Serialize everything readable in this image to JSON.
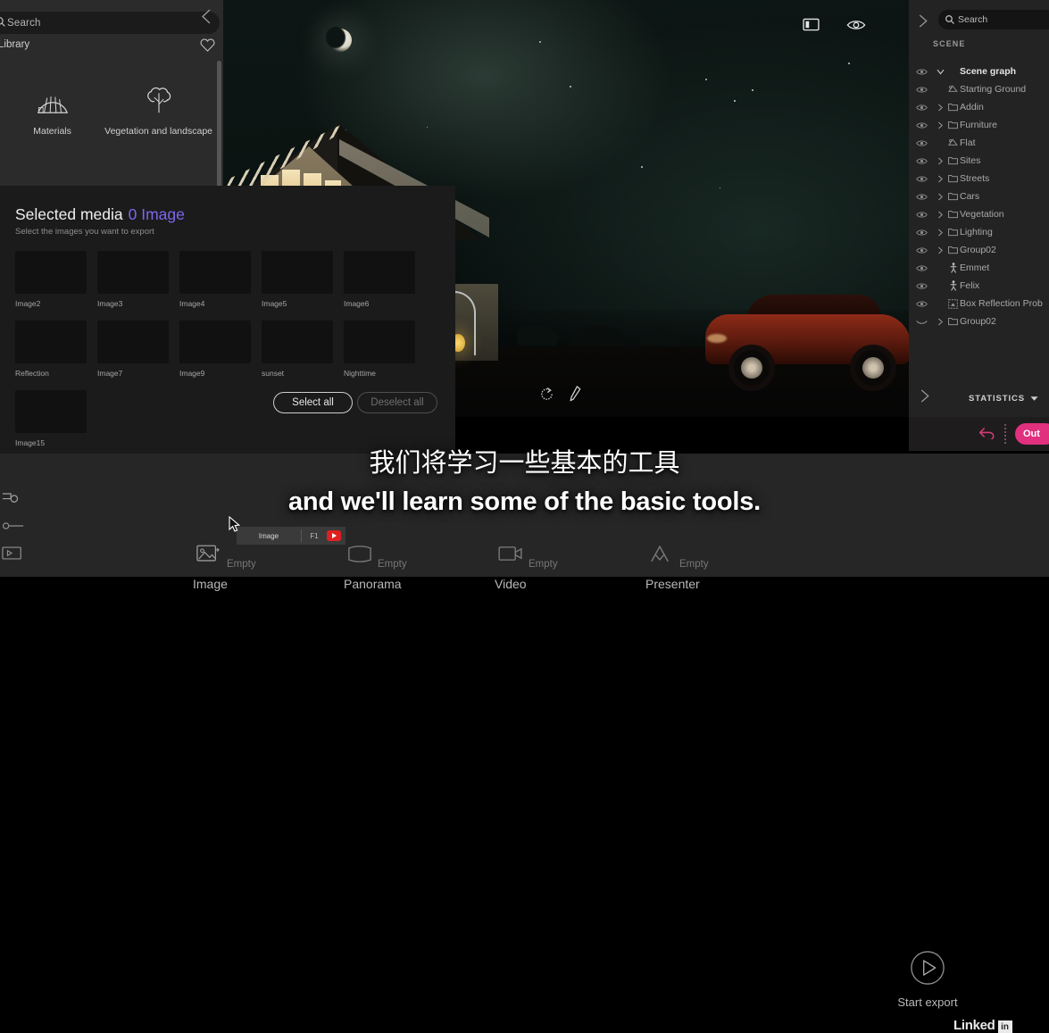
{
  "library": {
    "search_placeholder": "Search",
    "title": "Library",
    "categories": [
      {
        "label": "Materials",
        "icon": "materials-fan-icon"
      },
      {
        "label": "Vegetation and landscape",
        "icon": "tree-icon"
      }
    ]
  },
  "viewport": {
    "icons": [
      {
        "name": "panel-layout-icon"
      },
      {
        "name": "eye-visibility-icon"
      }
    ],
    "bottom_icons": [
      {
        "name": "refresh-rotate-icon"
      },
      {
        "name": "pen-edit-icon"
      }
    ]
  },
  "scene": {
    "search_placeholder": "Search",
    "section_label": "SCENE",
    "tree": [
      {
        "label": "Scene graph",
        "icon": "none",
        "chevron": "down",
        "indent": 0,
        "root": true
      },
      {
        "label": "Starting Ground",
        "icon": "mesh",
        "chevron": "none",
        "indent": 1
      },
      {
        "label": "Addin",
        "icon": "folder",
        "chevron": "right",
        "indent": 1
      },
      {
        "label": "Furniture",
        "icon": "folder",
        "chevron": "right",
        "indent": 1
      },
      {
        "label": "Flat",
        "icon": "mesh",
        "chevron": "none",
        "indent": 1
      },
      {
        "label": "Sites",
        "icon": "folder",
        "chevron": "right",
        "indent": 1
      },
      {
        "label": "Streets",
        "icon": "folder",
        "chevron": "right",
        "indent": 1
      },
      {
        "label": "Cars",
        "icon": "folder",
        "chevron": "right",
        "indent": 1
      },
      {
        "label": "Vegetation",
        "icon": "folder",
        "chevron": "right",
        "indent": 1
      },
      {
        "label": "Lighting",
        "icon": "folder",
        "chevron": "right",
        "indent": 1
      },
      {
        "label": "Group02",
        "icon": "folder",
        "chevron": "right",
        "indent": 1
      },
      {
        "label": "Emmet",
        "icon": "person",
        "chevron": "none",
        "indent": 1
      },
      {
        "label": "Felix",
        "icon": "person",
        "chevron": "none",
        "indent": 1
      },
      {
        "label": "Box Reflection Prob",
        "icon": "probe",
        "chevron": "none",
        "indent": 1
      },
      {
        "label": "Group02",
        "icon": "folder",
        "chevron": "right",
        "indent": 1,
        "eye": "hidden"
      }
    ],
    "statistics_label": "STATISTICS"
  },
  "undo_bar": {
    "undo_icon": "undo-arrow-icon",
    "pill_label": "Out"
  },
  "media": {
    "title": "Selected media",
    "count": "0 Image",
    "subtitle": "Select the images you want to export",
    "select_all": "Select all",
    "deselect_all": "Deselect all",
    "thumbnails": [
      {
        "caption": "Image2",
        "style": "t-img2"
      },
      {
        "caption": "Image3",
        "style": "t-img3"
      },
      {
        "caption": "Image4",
        "style": "t-img4"
      },
      {
        "caption": "Image5",
        "style": "t-img5"
      },
      {
        "caption": "Image6",
        "style": "t-img6"
      },
      {
        "caption": "Reflection",
        "style": "t-refl"
      },
      {
        "caption": "Image7",
        "style": "t-img7"
      },
      {
        "caption": "Image9",
        "style": "t-img9"
      },
      {
        "caption": "sunset",
        "style": "t-sunset"
      },
      {
        "caption": "Nighttime",
        "style": "t-night"
      },
      {
        "caption": "Image15",
        "style": "t-img15"
      }
    ]
  },
  "export_bar": {
    "tabs": [
      {
        "name": "Image",
        "status": "Empty",
        "icon": "image-export-icon"
      },
      {
        "name": "Panorama",
        "status": "Empty",
        "icon": "panorama-export-icon"
      },
      {
        "name": "Video",
        "status": "Empty",
        "icon": "video-export-icon"
      },
      {
        "name": "Presenter",
        "status": "Empty",
        "icon": "presenter-export-icon"
      }
    ],
    "tooltip": {
      "label": "Image",
      "shortcut": "F1",
      "badge": "video-badge"
    },
    "start_export": "Start export"
  },
  "watermark": {
    "text": "Linked",
    "mark": "in"
  },
  "subtitles": {
    "chinese": "我们将学习一些基本的工具",
    "english": "and we'll learn some of the basic tools."
  },
  "colors": {
    "accent_purple": "#7b68ee",
    "accent_pink": "#e0307e",
    "panel_bg": "#2b2b2b",
    "scene_bg": "#232323",
    "media_bg": "#1b1b1b",
    "bottom_bg": "#262626"
  }
}
